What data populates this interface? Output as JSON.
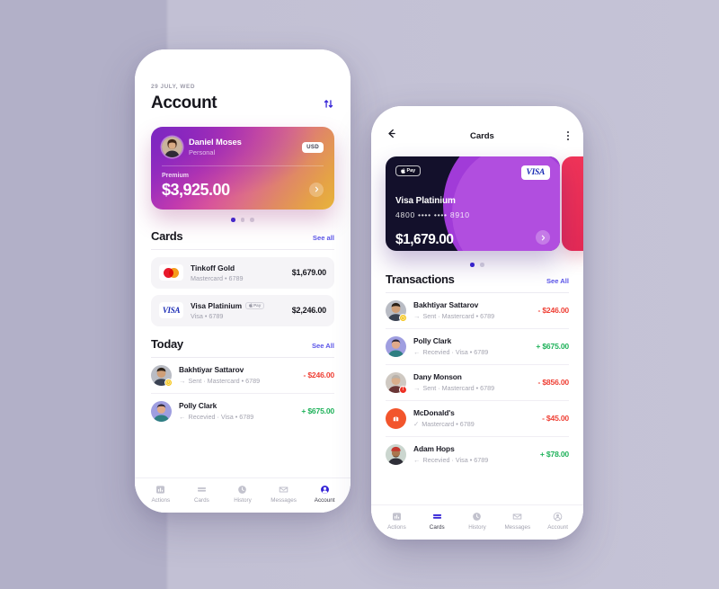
{
  "theme": {
    "background": "#b8b6cc",
    "accent": "#5a54e8",
    "active_dot": "#3524d6",
    "positive": "#1fb25a",
    "negative": "#ef4136"
  },
  "account_screen": {
    "date": "29 JULY, WED",
    "title": "Account",
    "sort_icon": "transfer-sort-icon",
    "account_card": {
      "name": "Daniel Moses",
      "account_type": "Personal",
      "currency_badge": "USD",
      "tier": "Premium",
      "balance": "$3,925.00",
      "chevron": "chevron-right-icon",
      "gradient_from": "#7b2fc4",
      "gradient_to": "#e8b43c"
    },
    "carousel_dots": 3,
    "carousel_active": 0,
    "cards_section": {
      "title": "Cards",
      "link": "See all",
      "items": [
        {
          "brand": "mastercard",
          "name": "Tinkoff Gold",
          "sub": "Mastercard • 6789",
          "amount": "$1,679.00",
          "apple_pay": false
        },
        {
          "brand": "visa",
          "name": "Visa Platinium",
          "sub": "Visa • 6789",
          "amount": "$2,246.00",
          "apple_pay": true,
          "apple_pay_label": "Pay"
        }
      ]
    },
    "today_section": {
      "title": "Today",
      "link": "See All",
      "items": [
        {
          "name": "Bakhtiyar Sattarov",
          "direction": "→",
          "sub": "Sent · Mastercard • 6789",
          "amount": "- $246.00",
          "sign": "neg",
          "badge": "warn",
          "avatar": "man-dark-hair"
        },
        {
          "name": "Polly Clark",
          "direction": "←",
          "sub": "Recevied · Visa • 6789",
          "amount": "+ $675.00",
          "sign": "pos",
          "badge": "none",
          "avatar": "woman-teal"
        }
      ]
    },
    "tabbar": {
      "active": "Account",
      "items": [
        {
          "icon": "chart-bars-icon",
          "label": "Actions"
        },
        {
          "icon": "credit-card-icon",
          "label": "Cards"
        },
        {
          "icon": "clock-icon",
          "label": "History"
        },
        {
          "icon": "envelope-icon",
          "label": "Messages"
        },
        {
          "icon": "person-circle-icon",
          "label": "Account"
        }
      ]
    }
  },
  "cards_screen": {
    "back_icon": "arrow-left-icon",
    "title": "Cards",
    "menu_icon": "kebab-menu-icon",
    "featured_card": {
      "apple_pay_label": "Pay",
      "brand": "VISA",
      "name": "Visa Platinium",
      "number": "4800 •••• •••• 8910",
      "balance": "$1,679.00",
      "chevron": "chevron-right-icon",
      "base_color": "#13102b",
      "swoosh_color": "#a13bd8"
    },
    "peek_card_color": "#ef3358",
    "carousel_dots": 2,
    "carousel_active": 0,
    "transactions_section": {
      "title": "Transactions",
      "link": "See All",
      "items": [
        {
          "name": "Bakhtiyar Sattarov",
          "direction": "→",
          "sub": "Sent · Mastercard • 6789",
          "amount": "- $246.00",
          "sign": "neg",
          "badge": "warn",
          "avatar": "man-dark-hair"
        },
        {
          "name": "Polly Clark",
          "direction": "←",
          "sub": "Recevied · Visa • 6789",
          "amount": "+ $675.00",
          "sign": "pos",
          "badge": "none",
          "avatar": "woman-teal"
        },
        {
          "name": "Dany Monson",
          "direction": "→",
          "sub": "Sent · Mastercard • 6789",
          "amount": "- $856.00",
          "sign": "neg",
          "badge": "alert",
          "avatar": "man-grey-hair"
        },
        {
          "name": "McDonald's",
          "direction": "✓",
          "sub": "Mastercard • 6789",
          "amount": "- $45.00",
          "sign": "neg",
          "badge": "none",
          "avatar": "mcdonalds-brand"
        },
        {
          "name": "Adam Hops",
          "direction": "←",
          "sub": "Recevied · Visa • 6789",
          "amount": "+ $78.00",
          "sign": "pos",
          "badge": "none",
          "avatar": "man-red-beanie"
        }
      ]
    },
    "tabbar": {
      "active": "Cards",
      "items": [
        {
          "icon": "chart-bars-icon",
          "label": "Actions"
        },
        {
          "icon": "credit-card-icon",
          "label": "Cards"
        },
        {
          "icon": "clock-icon",
          "label": "History"
        },
        {
          "icon": "envelope-icon",
          "label": "Messages"
        },
        {
          "icon": "person-circle-icon",
          "label": "Account"
        }
      ]
    }
  }
}
